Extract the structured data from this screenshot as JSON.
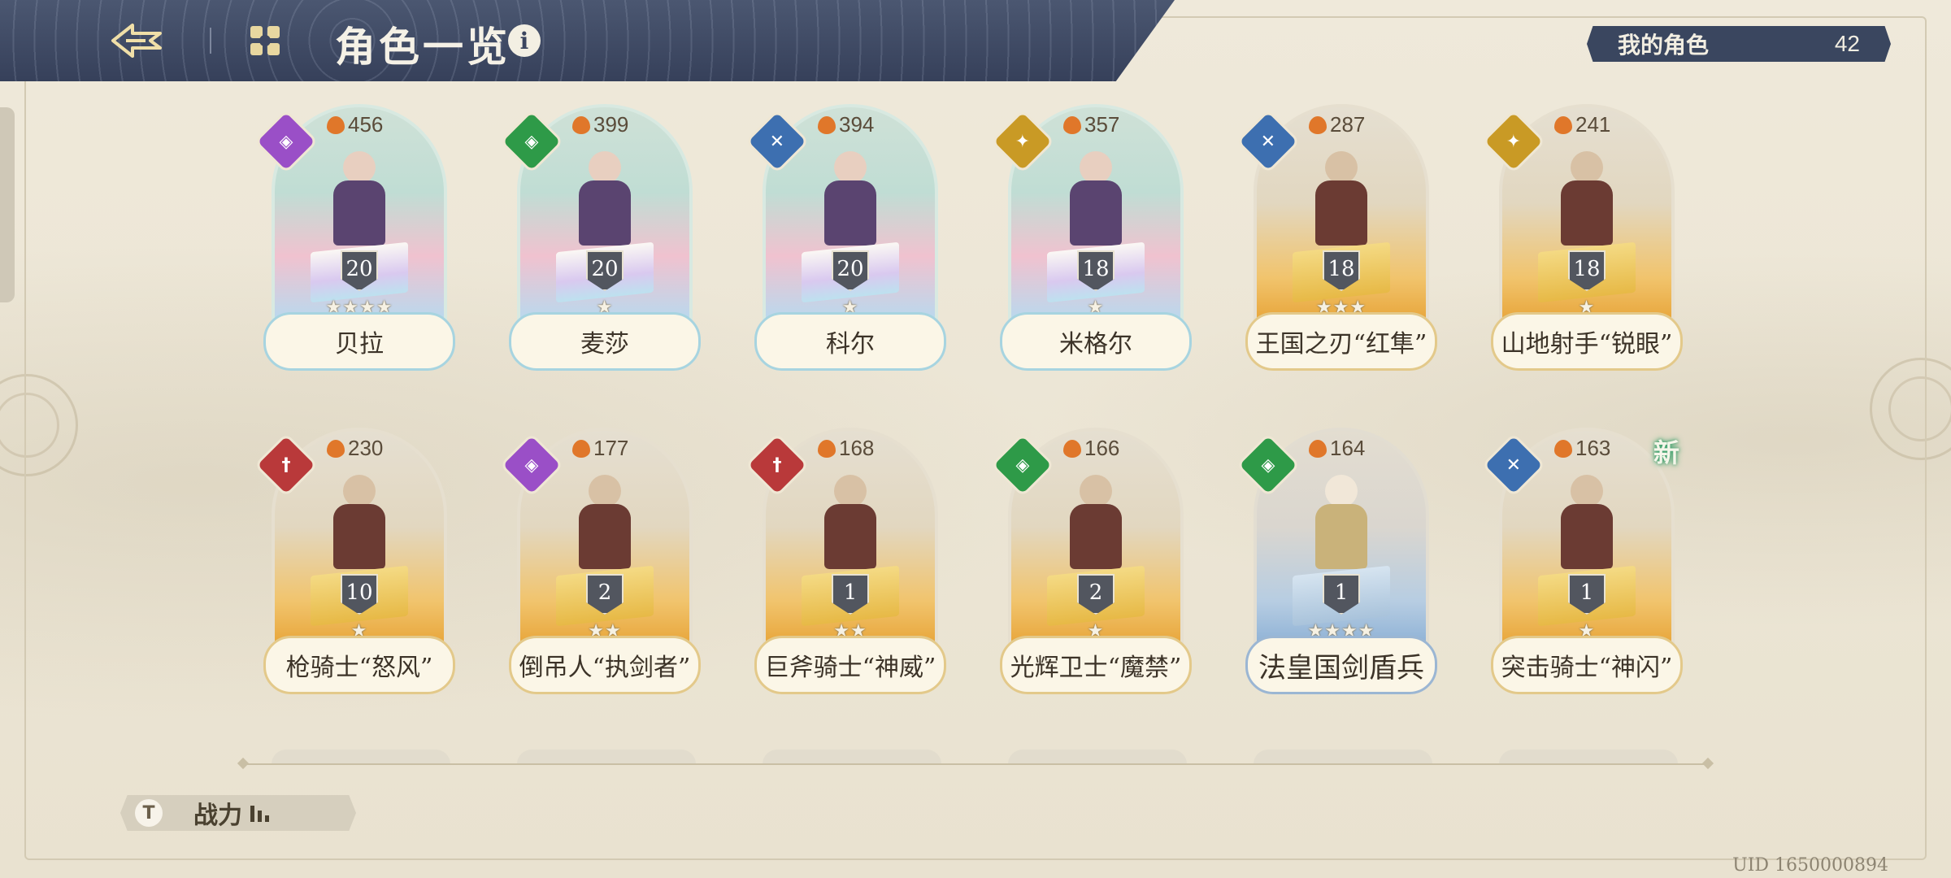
{
  "header": {
    "title": "角色一览",
    "info_icon": "i"
  },
  "my_characters": {
    "label": "我的角色",
    "count": "42"
  },
  "rows": [
    [
      {
        "name": "贝拉",
        "power": "456",
        "level": "20",
        "stars": "★★★★",
        "elem": "purple",
        "elem_icon": "◈",
        "bg": "rainbow",
        "new": ""
      },
      {
        "name": "麦莎",
        "power": "399",
        "level": "20",
        "stars": "★",
        "elem": "green",
        "elem_icon": "◈",
        "bg": "rainbow",
        "new": ""
      },
      {
        "name": "科尔",
        "power": "394",
        "level": "20",
        "stars": "★",
        "elem": "blue",
        "elem_icon": "✕",
        "bg": "rainbow",
        "new": ""
      },
      {
        "name": "米格尔",
        "power": "357",
        "level": "18",
        "stars": "★",
        "elem": "gold",
        "elem_icon": "✦",
        "bg": "rainbow",
        "new": ""
      },
      {
        "name": "王国之刃“红隼”",
        "power": "287",
        "level": "18",
        "stars": "★★★",
        "elem": "blue",
        "elem_icon": "✕",
        "bg": "gold",
        "new": ""
      },
      {
        "name": "山地射手“锐眼”",
        "power": "241",
        "level": "18",
        "stars": "★",
        "elem": "gold",
        "elem_icon": "✦",
        "bg": "gold",
        "new": ""
      }
    ],
    [
      {
        "name": "枪骑士“怒风”",
        "power": "230",
        "level": "10",
        "stars": "★",
        "elem": "red",
        "elem_icon": "†",
        "bg": "gold",
        "new": ""
      },
      {
        "name": "倒吊人“执剑者”",
        "power": "177",
        "level": "2",
        "stars": "★★",
        "elem": "purple",
        "elem_icon": "◈",
        "bg": "gold",
        "new": ""
      },
      {
        "name": "巨斧骑士“神威”",
        "power": "168",
        "level": "1",
        "stars": "★★",
        "elem": "red",
        "elem_icon": "†",
        "bg": "gold",
        "new": ""
      },
      {
        "name": "光辉卫士“魔禁”",
        "power": "166",
        "level": "2",
        "stars": "★",
        "elem": "green",
        "elem_icon": "◈",
        "bg": "gold",
        "new": ""
      },
      {
        "name": "法皇国剑盾兵",
        "power": "164",
        "level": "1",
        "stars": "★★★★",
        "elem": "green",
        "elem_icon": "◈",
        "bg": "blue",
        "new": ""
      },
      {
        "name": "突击骑士“神闪”",
        "power": "163",
        "level": "1",
        "stars": "★",
        "elem": "blue",
        "elem_icon": "✕",
        "bg": "gold",
        "new": "新"
      }
    ]
  ],
  "sort": {
    "label": "战力",
    "icon": "T"
  },
  "uid": "UID 1650000894",
  "icons": {
    "back": "back-arrow-icon",
    "menu": "grid-menu-icon"
  }
}
